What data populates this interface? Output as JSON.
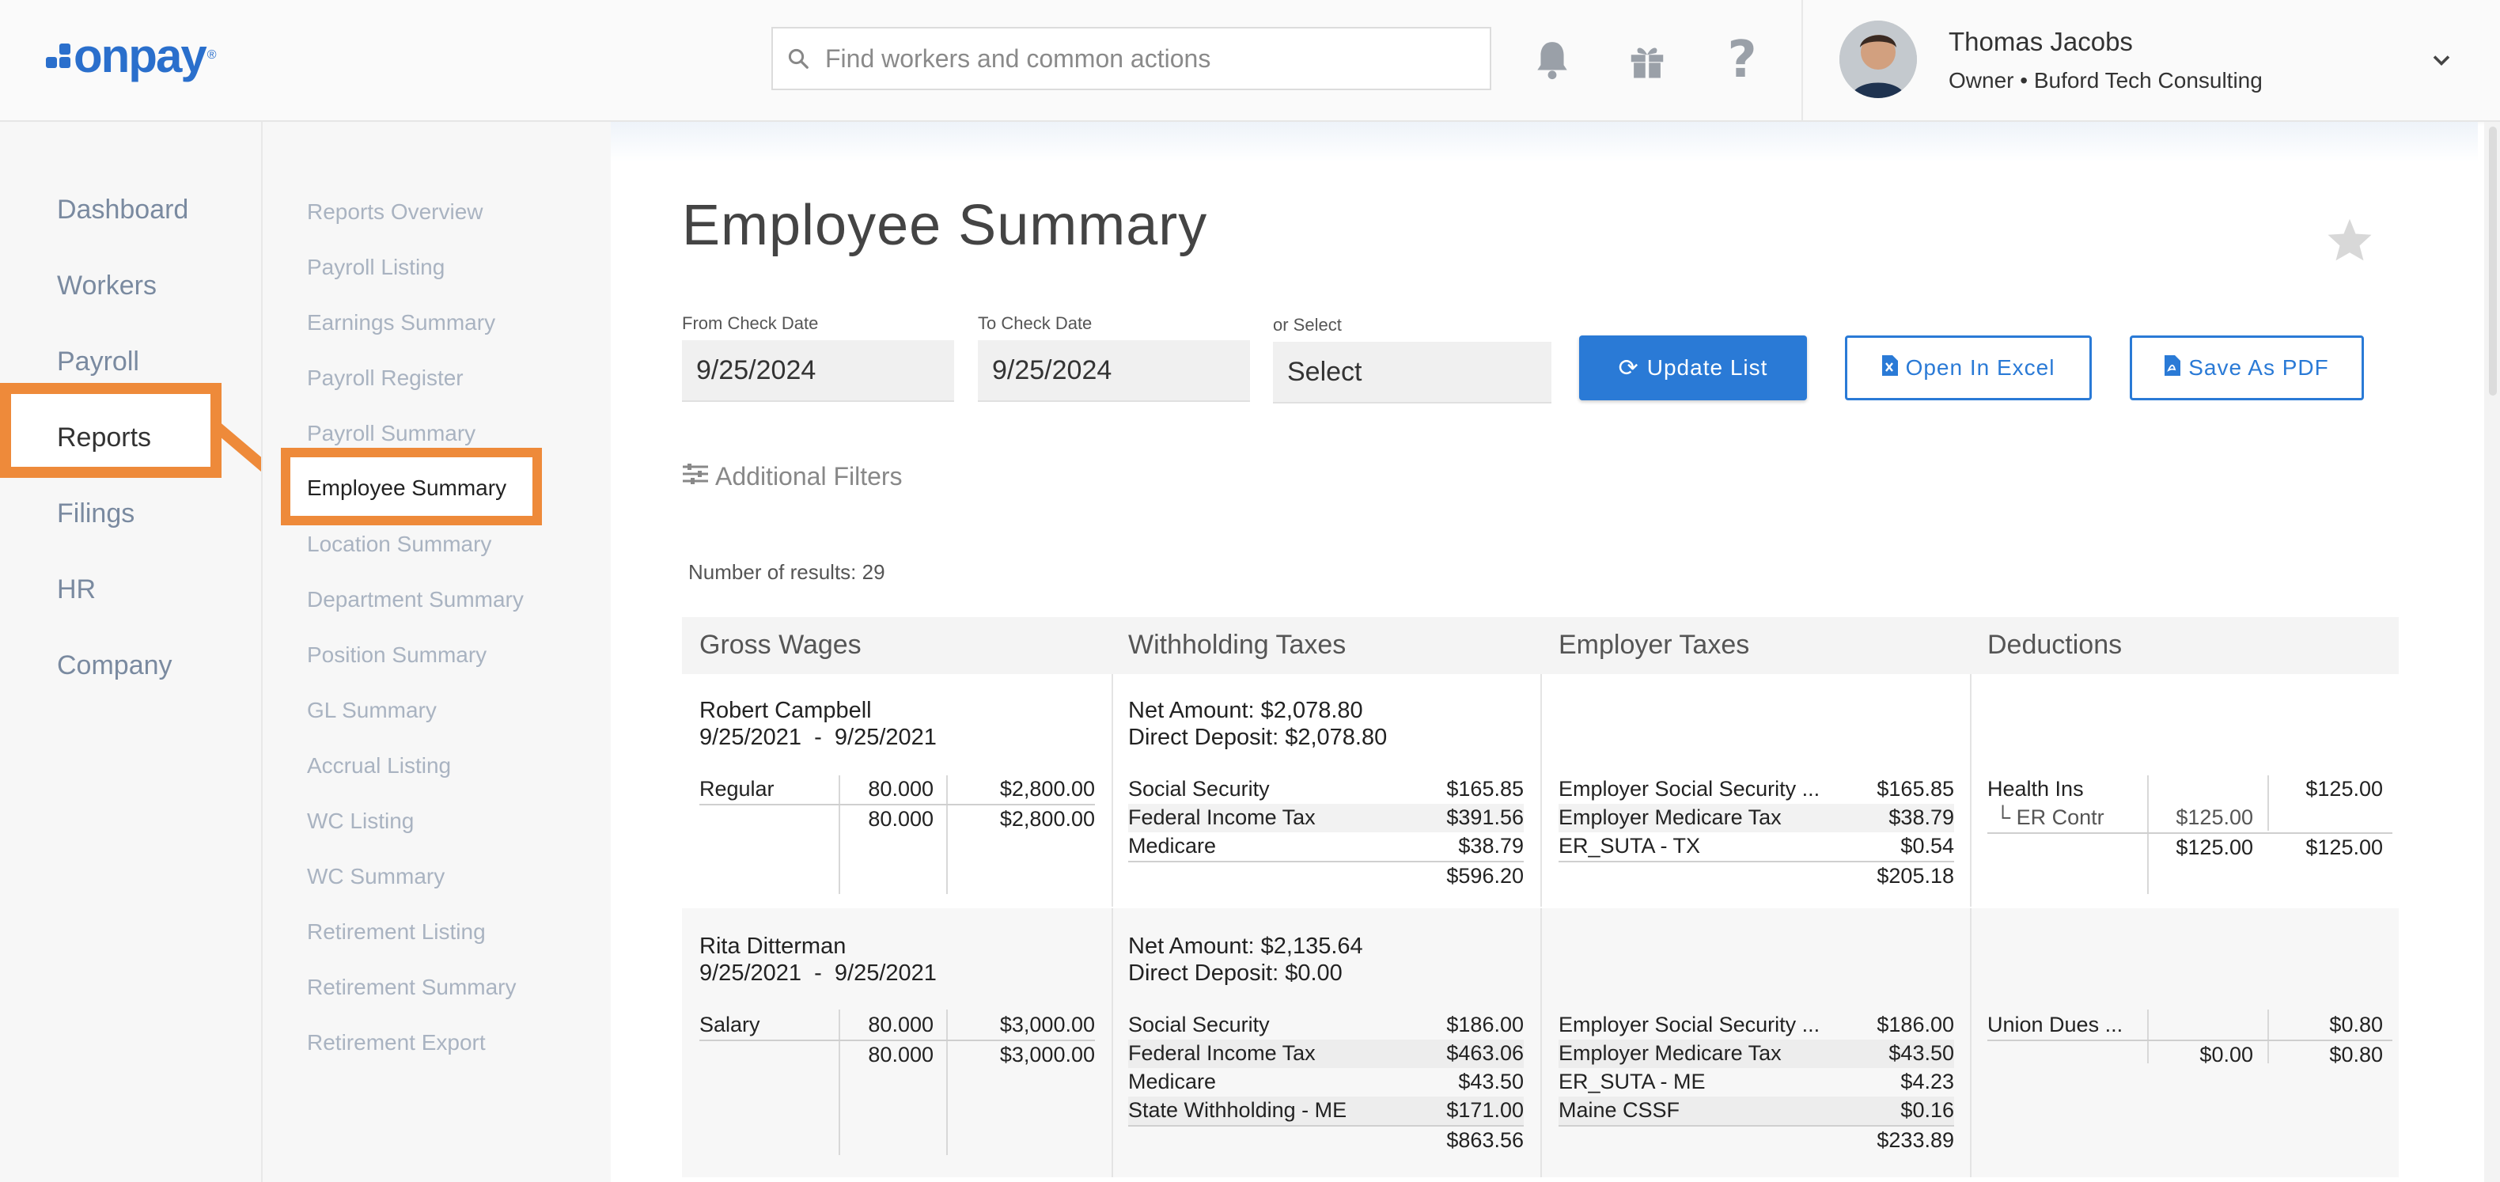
{
  "header": {
    "logo_text": "onpay",
    "logo_mark": "®",
    "search_placeholder": "Find workers and common actions",
    "user_name": "Thomas Jacobs",
    "user_role": "Owner • Buford Tech Consulting"
  },
  "nav": {
    "items": [
      "Dashboard",
      "Workers",
      "Payroll",
      "Reports",
      "Filings",
      "HR",
      "Company"
    ],
    "active": "Reports"
  },
  "subnav": {
    "items": [
      "Reports Overview",
      "Payroll Listing",
      "Earnings Summary",
      "Payroll Register",
      "Payroll Summary",
      "Employee Summary",
      "Location Summary",
      "Department Summary",
      "Position Summary",
      "GL Summary",
      "Accrual Listing",
      "WC Listing",
      "WC Summary",
      "Retirement Listing",
      "Retirement Summary",
      "Retirement Export"
    ],
    "active": "Employee Summary"
  },
  "page": {
    "title": "Employee Summary",
    "from_label": "From Check Date",
    "from_value": "9/25/2024",
    "to_label": "To Check Date",
    "to_value": "9/25/2024",
    "select_label": "or Select",
    "select_value": "Select",
    "update_button": "Update List",
    "excel_button": "Open In Excel",
    "pdf_button": "Save As PDF",
    "filters_label": "Additional Filters",
    "results_label": "Number of results: 29"
  },
  "table": {
    "headers": [
      "Gross Wages",
      "Withholding Taxes",
      "Employer Taxes",
      "Deductions"
    ],
    "employees": [
      {
        "name": "Robert Campbell",
        "period": "9/25/2021  -  9/25/2021",
        "net": "Net Amount: $2,078.80",
        "deposit": "Direct Deposit: $2,078.80",
        "wages": {
          "type": "Regular",
          "hours": "80.000",
          "amount": "$2,800.00",
          "total_hours": "80.000",
          "total_amount": "$2,800.00"
        },
        "withholding": [
          [
            "Social Security",
            "$165.85"
          ],
          [
            "Federal Income Tax",
            "$391.56"
          ],
          [
            "Medicare",
            "$38.79"
          ]
        ],
        "withholding_total": "$596.20",
        "employer": [
          [
            "Employer Social Security ...",
            "$165.85"
          ],
          [
            "Employer Medicare Tax",
            "$38.79"
          ],
          [
            "ER_SUTA - TX",
            "$0.54"
          ]
        ],
        "employer_total": "$205.18",
        "deductions": {
          "name": "Health Ins",
          "amount": "$125.00",
          "sub_name": "└ ER Contr",
          "sub_amount": "$125.00",
          "total_er": "$125.00",
          "total": "$125.00"
        }
      },
      {
        "name": "Rita Ditterman",
        "period": "9/25/2021  -  9/25/2021",
        "net": "Net Amount: $2,135.64",
        "deposit": "Direct Deposit: $0.00",
        "wages": {
          "type": "Salary",
          "hours": "80.000",
          "amount": "$3,000.00",
          "total_hours": "80.000",
          "total_amount": "$3,000.00"
        },
        "withholding": [
          [
            "Social Security",
            "$186.00"
          ],
          [
            "Federal Income Tax",
            "$463.06"
          ],
          [
            "Medicare",
            "$43.50"
          ],
          [
            "State Withholding - ME",
            "$171.00"
          ]
        ],
        "withholding_total": "$863.56",
        "employer": [
          [
            "Employer Social Security ...",
            "$186.00"
          ],
          [
            "Employer Medicare Tax",
            "$43.50"
          ],
          [
            "ER_SUTA - ME",
            "$4.23"
          ],
          [
            "Maine CSSF",
            "$0.16"
          ]
        ],
        "employer_total": "$233.89",
        "deductions": {
          "name": "Union Dues ...",
          "amount": "$0.80",
          "total_er": "$0.00",
          "total": "$0.80"
        }
      }
    ]
  },
  "colors": {
    "accent": "#2a7ad6",
    "highlight": "#ee8a3a"
  },
  "icons": {
    "search": "search-icon",
    "bell": "bell-icon",
    "gift": "gift-icon",
    "help": "help-icon",
    "chevron": "chevron-down-icon",
    "star": "star-icon",
    "refresh": "refresh-icon",
    "excel": "excel-file-icon",
    "pdf": "pdf-file-icon",
    "filters": "sliders-icon"
  }
}
